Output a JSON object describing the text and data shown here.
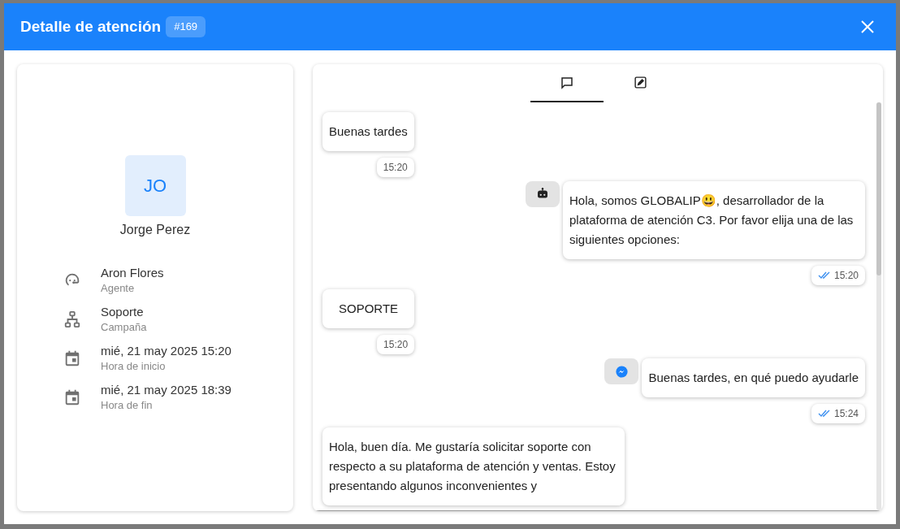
{
  "dialog": {
    "title": "Detalle de atención",
    "badge": "#169"
  },
  "contact": {
    "initials": "JO",
    "name": "Jorge Perez"
  },
  "details": [
    {
      "kind": "agent",
      "value": "Aron Flores",
      "label": "Agente"
    },
    {
      "kind": "campaign",
      "value": "Soporte",
      "label": "Campaña"
    },
    {
      "kind": "date",
      "value": "mié, 21 may 2025 15:20",
      "label": "Hora de inicio"
    },
    {
      "kind": "date",
      "value": "mié, 21 may 2025 18:39",
      "label": "Hora de fin"
    }
  ],
  "tabs": [
    {
      "kind": "chat",
      "selected": true
    },
    {
      "kind": "notes",
      "selected": false
    }
  ],
  "messages": [
    {
      "kind": "incoming",
      "text": "Buenas tardes",
      "time": "15:20",
      "read": false
    },
    {
      "kind": "bot",
      "text": "Hola, somos GLOBALIP😃, desarrollador de la plataforma de atención C3. Por favor elija una de las siguientes opciones:",
      "time": "15:20",
      "read": true
    },
    {
      "kind": "incoming",
      "text": "SOPORTE",
      "time": "15:20",
      "read": false
    },
    {
      "kind": "messenger",
      "text": "Buenas tardes, en qué puedo ayudarle",
      "time": "15:24",
      "read": true
    },
    {
      "kind": "incoming",
      "text": "Hola, buen día. Me gustaría solicitar soporte con respecto a su plataforma de atención y ventas. Estoy presentando algunos inconvenientes y"
    }
  ]
}
